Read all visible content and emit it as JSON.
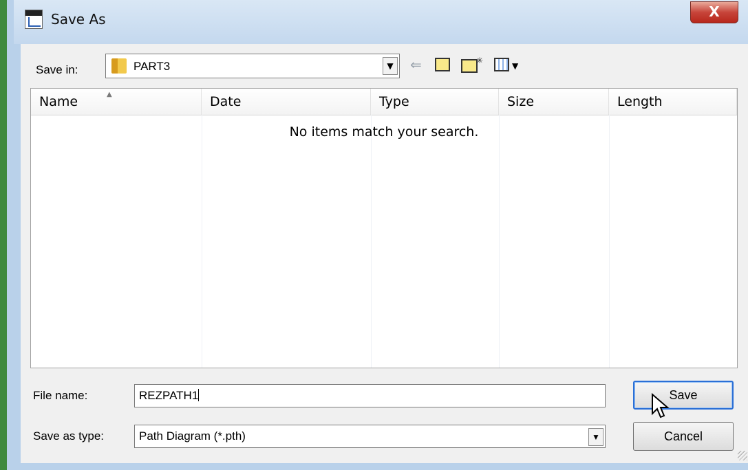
{
  "window": {
    "title": "Save As",
    "close_label": "X"
  },
  "toolbar": {
    "save_in_label": "Save in:",
    "save_in_value": "PART3",
    "icons": [
      "back-arrow-icon",
      "up-folder-icon",
      "new-folder-icon",
      "views-menu-icon"
    ]
  },
  "list": {
    "columns": [
      {
        "label": "Name"
      },
      {
        "label": "Date"
      },
      {
        "label": "Type"
      },
      {
        "label": "Size"
      },
      {
        "label": "Length"
      }
    ],
    "sorted_by": "Name",
    "empty_message": "No items match your search."
  },
  "form": {
    "file_name_label": "File name:",
    "file_name_value": "REZPATH1",
    "save_as_type_label": "Save as type:",
    "save_as_type_value": "Path Diagram (*.pth)"
  },
  "buttons": {
    "save_label": "Save",
    "cancel_label": "Cancel"
  }
}
